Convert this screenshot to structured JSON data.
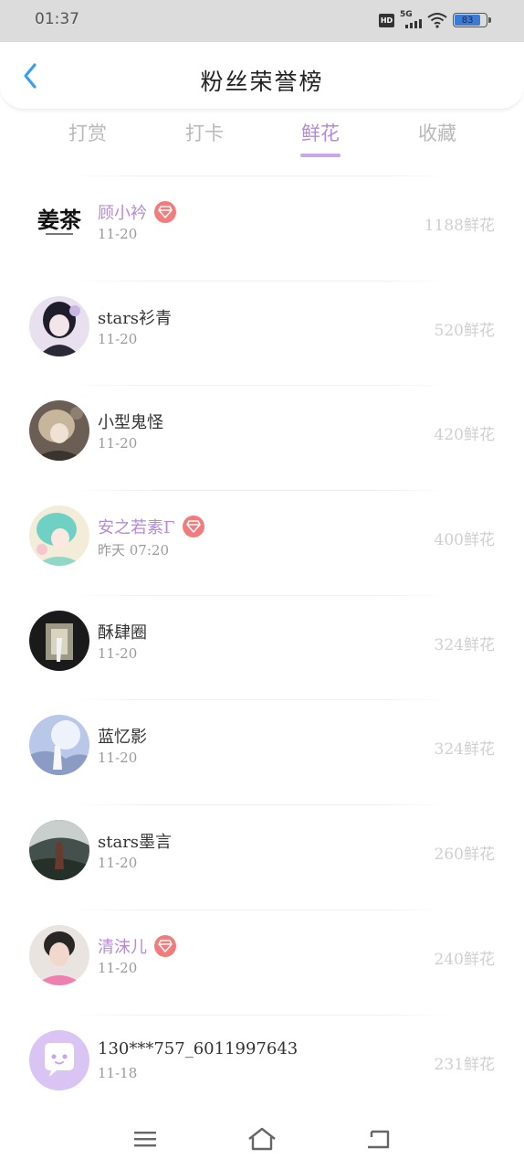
{
  "status": {
    "time": "01:37",
    "hd": "HD",
    "network": "5G",
    "battery_level": "83"
  },
  "header": {
    "title": "粉丝荣誉榜",
    "back_icon": "chevron-left-icon",
    "accent_color": "#3b9ee8"
  },
  "tabs": [
    {
      "label": "打赏",
      "active": false
    },
    {
      "label": "打卡",
      "active": false
    },
    {
      "label": "鲜花",
      "active": true
    },
    {
      "label": "收藏",
      "active": false
    }
  ],
  "ranking": [
    {
      "name": "顾小衿",
      "vip": true,
      "date": "11-20",
      "count": "1188鲜花",
      "avatar": "calligraphy-logo",
      "avatar_text": "姜茶"
    },
    {
      "name": "stars衫青",
      "vip": false,
      "date": "11-20",
      "count": "520鲜花",
      "avatar": "anime-dark-hair"
    },
    {
      "name": "小型鬼怪",
      "vip": false,
      "date": "11-20",
      "count": "420鲜花",
      "avatar": "anime-brown"
    },
    {
      "name": "安之若素Γ",
      "vip": true,
      "date": "昨天 07:20",
      "count": "400鲜花",
      "avatar": "anime-green-hair"
    },
    {
      "name": "酥肆圈",
      "vip": false,
      "date": "11-20",
      "count": "324鲜花",
      "avatar": "dark-scene"
    },
    {
      "name": "蓝忆影",
      "vip": false,
      "date": "11-20",
      "count": "324鲜花",
      "avatar": "bright-sky"
    },
    {
      "name": "stars墨言",
      "vip": false,
      "date": "11-20",
      "count": "260鲜花",
      "avatar": "forest-scene"
    },
    {
      "name": "清沫儿",
      "vip": true,
      "date": "11-20",
      "count": "240鲜花",
      "avatar": "portrait-pink"
    },
    {
      "name": "130***757_6011997643",
      "vip": false,
      "date": "11-18",
      "count": "231鲜花",
      "avatar": "default-chat-avatar"
    }
  ],
  "colors": {
    "vip_name": "#b58ad8",
    "vip_badge": "#f27b7b",
    "active_tab": "#b58ad8",
    "count_text": "#cfcfcf"
  },
  "nav": {
    "menu_icon": "menu-icon",
    "home_icon": "home-icon",
    "back_icon": "back-icon"
  }
}
